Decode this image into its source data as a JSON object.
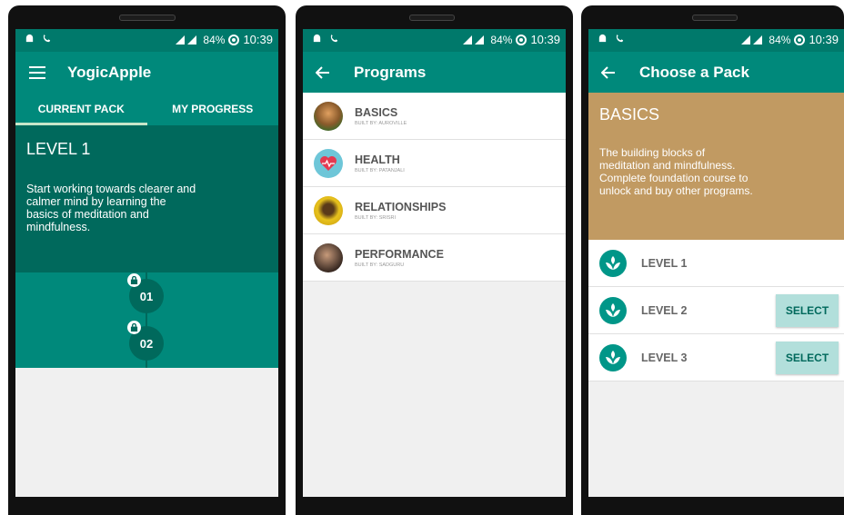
{
  "status_bar": {
    "battery": "84%",
    "time": "10:39"
  },
  "screen1": {
    "app_title": "YogicApple",
    "tabs": [
      {
        "label": "CURRENT PACK"
      },
      {
        "label": "MY PROGRESS"
      }
    ],
    "hero_title": "LEVEL 1",
    "hero_text": "Start working towards clearer and calmer mind by learning the basics of meditation and mindfulness.",
    "levels": [
      {
        "label": "01"
      },
      {
        "label": "02"
      }
    ]
  },
  "screen2": {
    "title": "Programs",
    "programs": [
      {
        "name": "BASICS",
        "built_by": "BUILT BY: AUROVILLE"
      },
      {
        "name": "HEALTH",
        "built_by": "BUILT BY: PATANJALI"
      },
      {
        "name": "RELATIONSHIPS",
        "built_by": "BUILT BY: SRISRI"
      },
      {
        "name": "PERFORMANCE",
        "built_by": "BUILT BY: SADGURU"
      }
    ]
  },
  "screen3": {
    "title": "Choose a Pack",
    "pack_title": "BASICS",
    "pack_text": "The building blocks of meditation and mindfulness. Complete foundation course to unlock and buy other programs.",
    "levels": [
      {
        "label": "LEVEL 1",
        "button": ""
      },
      {
        "label": "LEVEL 2",
        "button": "SELECT"
      },
      {
        "label": "LEVEL 3",
        "button": "SELECT"
      }
    ]
  },
  "colors": {
    "primary": "#00897b",
    "primary_dark": "#00796b",
    "hero_dark": "#00695c",
    "pack_brown": "#c19a62",
    "button_light": "#b2dfdb"
  }
}
